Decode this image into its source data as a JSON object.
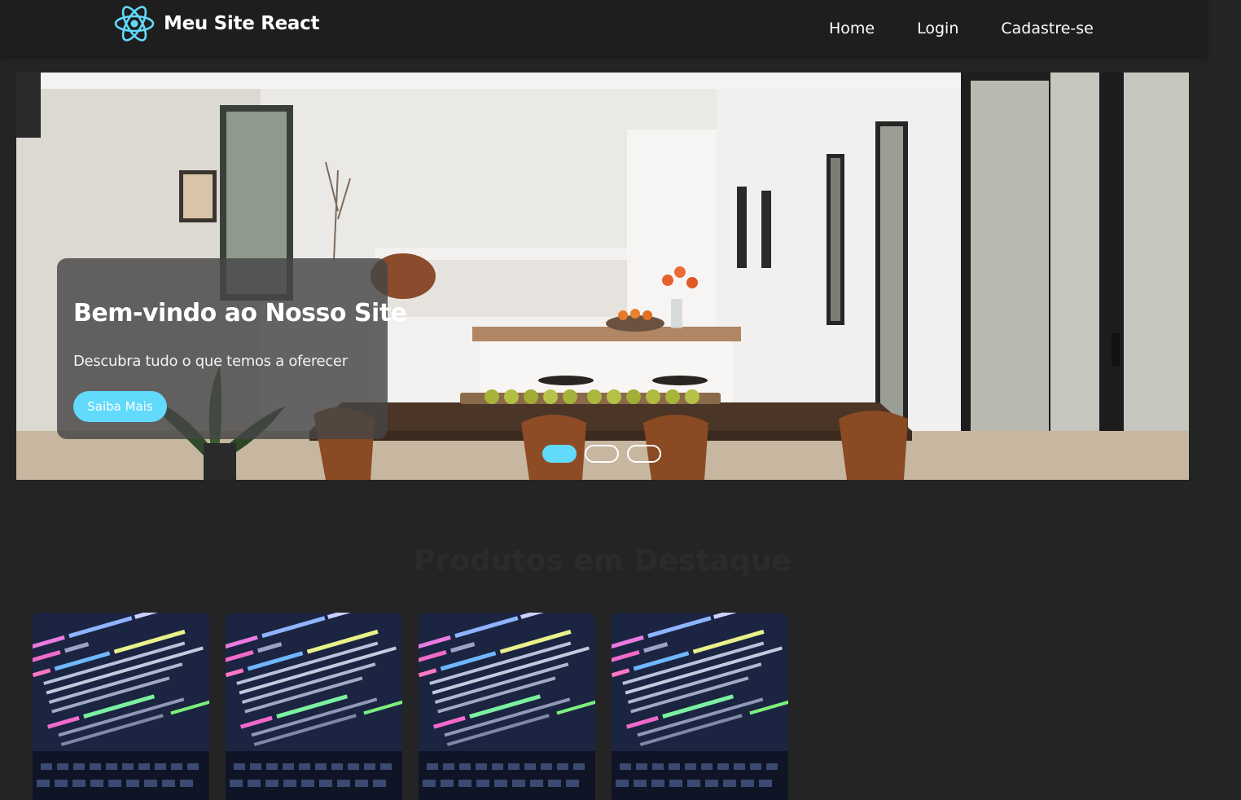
{
  "header": {
    "brand": "Meu Site React",
    "logo_icon": "react-atom-icon",
    "accent_color": "#61dafb",
    "nav": [
      {
        "label": "Home"
      },
      {
        "label": "Login"
      },
      {
        "label": "Cadastre-se"
      }
    ]
  },
  "hero": {
    "image": "dining-kitchen-interior-photo",
    "title": "Bem-vindo ao Nosso Site",
    "subtitle": "Descubra tudo o que temos a oferecer",
    "button_label": "Saiba Mais",
    "slide_count": 3,
    "active_slide": 1
  },
  "products": {
    "title": "Produtos em Destaque",
    "items": [
      {
        "image": "code-laptop-photo"
      },
      {
        "image": "code-laptop-photo"
      },
      {
        "image": "code-laptop-photo"
      },
      {
        "image": "code-laptop-photo"
      }
    ]
  }
}
